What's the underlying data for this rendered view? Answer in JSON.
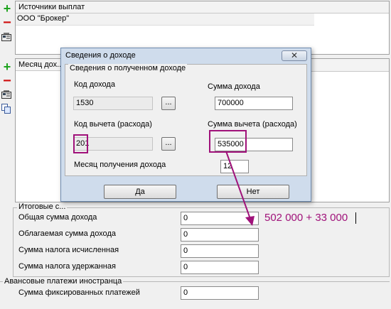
{
  "payment_sources": {
    "header": "Источники выплат",
    "items": [
      "ООО \"Брокер\""
    ]
  },
  "months_panel": {
    "header": "Месяц дох..."
  },
  "dialog": {
    "title": "Сведения о доходе",
    "group_title": "Сведения о полученном доходе",
    "income_code_label": "Код дохода",
    "income_code_value": "1530",
    "deduction_code_label": "Код вычета (расхода)",
    "deduction_code_value": "201",
    "income_sum_label": "Сумма дохода",
    "income_sum_value": "700000",
    "deduction_sum_label": "Сумма вычета (расхода)",
    "deduction_sum_value": "535000",
    "month_label": "Месяц получения дохода",
    "month_value": "12",
    "browse_label": "...",
    "yes_label": "Да",
    "no_label": "Нет"
  },
  "totals": {
    "group_title": "Итоговые с...",
    "total_income_label": "Общая сумма дохода",
    "total_income_value": "0",
    "taxable_income_label": "Облагаемая сумма дохода",
    "taxable_income_value": "0",
    "tax_calculated_label": "Сумма налога исчисленная",
    "tax_calculated_value": "0",
    "tax_withheld_label": "Сумма налога удержанная",
    "tax_withheld_value": "0"
  },
  "advances": {
    "group_title": "Авансовые платежи иностранца",
    "fixed_payments_label": "Сумма фиксированных платежей",
    "fixed_payments_value": "0"
  },
  "annotation": {
    "text": "502 000 + 33 000",
    "color": "#a0127a"
  },
  "icons": [
    "plus-icon",
    "minus-icon",
    "properties-icon",
    "copy-icon",
    "close-icon"
  ]
}
